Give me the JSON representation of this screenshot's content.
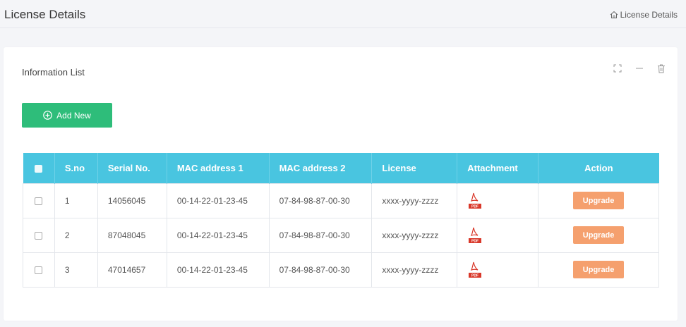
{
  "header": {
    "title": "License Details",
    "breadcrumb": "License Details"
  },
  "card": {
    "title": "Information List",
    "add_button": "Add New"
  },
  "table": {
    "columns": [
      "S.no",
      "Serial No.",
      "MAC address 1",
      "MAC address 2",
      "License",
      "Attachment",
      "Action"
    ],
    "rows": [
      {
        "sno": "1",
        "serial": "14056045",
        "mac1": "00-14-22-01-23-45",
        "mac2": "07-84-98-87-00-30",
        "license": "xxxx-yyyy-zzzz",
        "attachment": "PDF",
        "action": "Upgrade"
      },
      {
        "sno": "2",
        "serial": "87048045",
        "mac1": "00-14-22-01-23-45",
        "mac2": "07-84-98-87-00-30",
        "license": "xxxx-yyyy-zzzz",
        "attachment": "PDF",
        "action": "Upgrade"
      },
      {
        "sno": "3",
        "serial": "47014657",
        "mac1": "00-14-22-01-23-45",
        "mac2": "07-84-98-87-00-30",
        "license": "xxxx-yyyy-zzzz",
        "attachment": "PDF",
        "action": "Upgrade"
      }
    ]
  },
  "colors": {
    "header_bg": "#49c5e0",
    "add_button": "#2ebd7a",
    "upgrade_button": "#f5a06e",
    "pdf_red": "#d9382a"
  },
  "icons": {
    "breadcrumb": "home-icon",
    "tools": [
      "expand-icon",
      "minimize-icon",
      "trash-icon"
    ],
    "add": "plus-circle-icon",
    "attachment": "pdf-icon"
  }
}
